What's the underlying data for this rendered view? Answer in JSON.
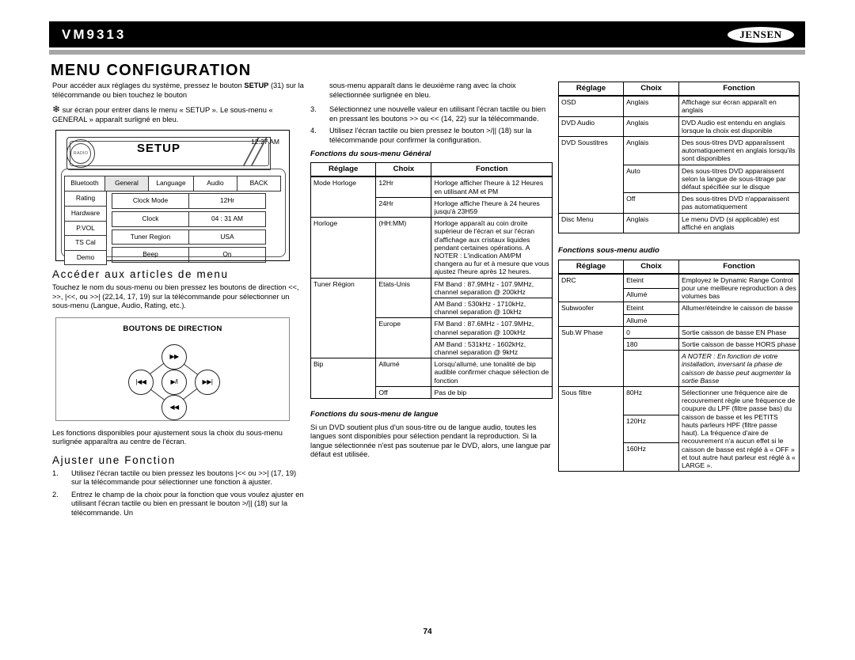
{
  "header": {
    "model": "VM9313",
    "brand": "JENSEN"
  },
  "page_title": "MENU CONFIGURATION",
  "page_number": "74",
  "column1": {
    "intro_part1": "Pour accéder aux réglages du système, pressez le bouton ",
    "intro_bold": "SETUP",
    "intro_part2": " (31) sur la télécommande ou bien touchez le bouton",
    "intro_part3": "sur écran pour entrer dans le menu « SETUP ». Le sous-menu « GENERAL » apparaît surligné en bleu.",
    "setup_mock": {
      "radio_label": "RADIO",
      "title": "SETUP",
      "clock": "12:27 AM",
      "tabs": [
        {
          "label": "Bluetooth",
          "selected": false
        },
        {
          "label": "General",
          "selected": true
        },
        {
          "label": "Language",
          "selected": false
        },
        {
          "label": "Audio",
          "selected": false
        },
        {
          "label": "BACK",
          "selected": false
        }
      ],
      "left_buttons": [
        "Rating",
        "Hardware",
        "P.VOL",
        "TS Cal",
        "Demo"
      ],
      "settings": [
        {
          "label": "Clock Mode",
          "value": "12Hr"
        },
        {
          "label": "Clock",
          "value": "04 :  31   AM"
        },
        {
          "label": "Tuner Region",
          "value": "USA"
        },
        {
          "label": "Beep",
          "value": "On"
        }
      ]
    },
    "section_access_title": "Accéder aux articles de menu",
    "section_access_body": "Touchez le nom du sous-menu ou bien pressez les boutons de direction <<, >>, |<<, ou >>| (22,14, 17, 19) sur la télécommande pour sélectionner un sous-menu (Langue, Audio, Rating, etc.).",
    "dir_box": {
      "title": "BOUTONS DE DIRECTION",
      "top_label": "▶▶",
      "left_label": "|◀◀",
      "center_label": "▶/ǀ",
      "right_label": "▶▶|",
      "bottom_label": "◀◀"
    },
    "after_dir_text": "Les fonctions disponibles pour ajustement sous la choix du sous-menu surlignée apparaîtra au centre de l'écran.",
    "section_adjust_title": "Ajuster une Fonction",
    "adjust_steps": [
      {
        "num": "1.",
        "text": "Utilisez l'écran tactile ou bien pressez les boutons |<< ou >>| (17, 19) sur la télécommande pour sélectionner une fonction à ajuster."
      },
      {
        "num": "2.",
        "text": "Entrez le champ de la choix pour la fonction que vous voulez ajuster en utilisant l'écran tactile ou bien en pressant le bouton >/|| (18) sur la télécommande. Un"
      }
    ]
  },
  "column2": {
    "continuation": "sous-menu apparaît dans le deuxième rang avec la choix sélectionnée surlignée en bleu.",
    "steps": [
      {
        "num": "3.",
        "text": "Sélectionnez une nouvelle valeur en utilisant l'écran tactile ou bien en pressant les boutons >> ou << (14, 22) sur la télécommande."
      },
      {
        "num": "4.",
        "text": "Utilisez l'écran tactile ou bien pressez le bouton >/|| (18) sur la télécommande pour confirmer la configuration."
      }
    ],
    "table_general_title": "Fonctions du sous-menu Général",
    "table_headers": [
      "Réglage",
      "Choix",
      "Fonction"
    ],
    "table_general_rows": [
      {
        "setting": "Mode Horloge",
        "choice": "12Hr",
        "function": "Horloge afficher l'heure à 12 Heures en utilisant AM et PM",
        "rowspan": 2
      },
      {
        "setting": "",
        "choice": "24Hr",
        "function": "Horloge affiche l'heure à 24 heures jusqu'à 23H59"
      },
      {
        "setting": "Horloge",
        "choice": "(HH:MM)",
        "function": "Horloge apparaît au coin droite supérieur de l'écran et sur l'écran d'affichage aux cristaux liquides pendant certaines opérations. A NOTER : L'indication AM/PM changera au fur et à mesure que vous ajustez l'heure après 12 heures."
      },
      {
        "setting": "Tuner Région",
        "choice": "Etats-Unis",
        "function": "FM Band : 87.9MHz - 107.9MHz, channel separation @ 200kHz",
        "rowspan": 4
      },
      {
        "setting": "",
        "choice": "",
        "function": "AM Band : 530kHz - 1710kHz, channel separation @ 10kHz"
      },
      {
        "setting": "",
        "choice": "Europe",
        "function": "FM Band : 87.6MHz - 107.9MHz, channel separation @ 100kHz"
      },
      {
        "setting": "",
        "choice": "",
        "function": "AM Band : 531kHz - 1602kHz, channel separation @ 9kHz"
      },
      {
        "setting": "Bip",
        "choice": "Allumé",
        "function": "Lorsqu'allumé, une tonalité de bip audible confirmer chaque sélection de fonction",
        "rowspan": 2
      },
      {
        "setting": "",
        "choice": "Off",
        "function": "Pas de bip"
      }
    ],
    "table_lang_title": "Fonctions du sous-menu de langue",
    "lang_body": "Si un DVD soutient plus d'un sous-titre ou de langue audio, toutes les langues sont disponibles pour sélection pendant la reproduction. Si la langue sélectionnée n'est pas soutenue par le DVD, alors, une langue par défaut est utilisée."
  },
  "column3": {
    "table_headers": [
      "Réglage",
      "Choix",
      "Fonction"
    ],
    "table_lang_rows": [
      {
        "setting": "OSD",
        "choice": "Anglais",
        "function": "Affichage sur écran apparaît en anglais"
      },
      {
        "setting": "DVD Audio",
        "choice": "Anglais",
        "function": "DVD Audio est entendu en anglais lorsque la choix est disponible"
      },
      {
        "setting": "DVD Soustitres",
        "choice": "Anglais",
        "function": "Des sous-titres DVD apparaîssent automatiquement en anglais lorsqu'ils sont disponibles"
      },
      {
        "setting": "",
        "choice": "Auto",
        "function": "Des sous-titres DVD apparaissent selon la langue de sous-titrage par défaut spécifiée sur le disque"
      },
      {
        "setting": "",
        "choice": "Off",
        "function": "Des sous-titres DVD n'apparaissent pas automatiquement"
      },
      {
        "setting": "Disc Menu",
        "choice": "Anglais",
        "function": "Le menu DVD (si applicable) est affiché en anglais"
      }
    ],
    "table_audio_title": "Fonctions sous-menu audio",
    "table_audio_rows": [
      {
        "setting": "DRC",
        "choice": "Eteint",
        "function": "Employez le Dynamic Range Control pour une meilleure reproduction à des volumes bas"
      },
      {
        "setting": "",
        "choice": "Allumé",
        "function": ""
      },
      {
        "setting": "Subwoofer",
        "choice": "Eteint",
        "function": "Allumer/éteindre le caisson de basse"
      },
      {
        "setting": "",
        "choice": "Allumé",
        "function": ""
      },
      {
        "setting": "Sub.W Phase",
        "choice": "0",
        "function": "Sortie caisson de basse EN Phase"
      },
      {
        "setting": "",
        "choice": "180",
        "function": "Sortie caisson de basse HORS phase"
      },
      {
        "setting": "",
        "choice": "",
        "function": "A NOTER : En fonction de votre installation, inversant la phase de caisson de basse peut augmenter la sortie Basse",
        "italic": true
      },
      {
        "setting": "Sous filtre",
        "choice": "80Hz",
        "function": "Sélectionner une fréquence aire de recouvrement règle une fréquence de coupure du LPF (filtre passe bas) du caisson de basse et les PETITS hauts parleurs HPF (filtre passe haut). La fréquence d'aire de recouvrement n'a aucun effet si le caisson de basse est réglé à « OFF » et tout autre haut parleur est réglé à « LARGE »."
      },
      {
        "setting": "",
        "choice": "120Hz",
        "function": ""
      },
      {
        "setting": "",
        "choice": "160Hz",
        "function": ""
      }
    ]
  }
}
